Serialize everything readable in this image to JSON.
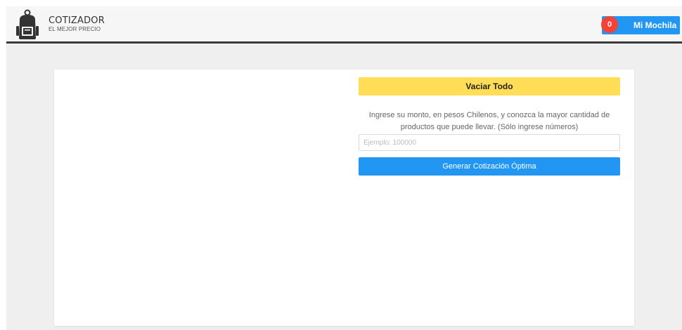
{
  "header": {
    "brand_title": "COTIZADOR",
    "brand_subtitle": "EL MEJOR PRECIO",
    "logo_icon": "backpack-icon",
    "cart": {
      "label": "Mi Mochila",
      "count": "0"
    }
  },
  "main": {
    "clear_button_label": "Vaciar Todo",
    "instructions": "Ingrese su monto, en pesos Chilenos, y conozca la mayor cantidad de productos que puede llevar. (Sólo ingrese números)",
    "amount_input": {
      "value": "",
      "placeholder": "Ejemplo: 100000"
    },
    "generate_button_label": "Generar Cotización Óptima"
  },
  "colors": {
    "primary": "#2196f3",
    "warning": "#ffdd57",
    "badge": "#f44336",
    "header_border": "#3a3a3a"
  }
}
